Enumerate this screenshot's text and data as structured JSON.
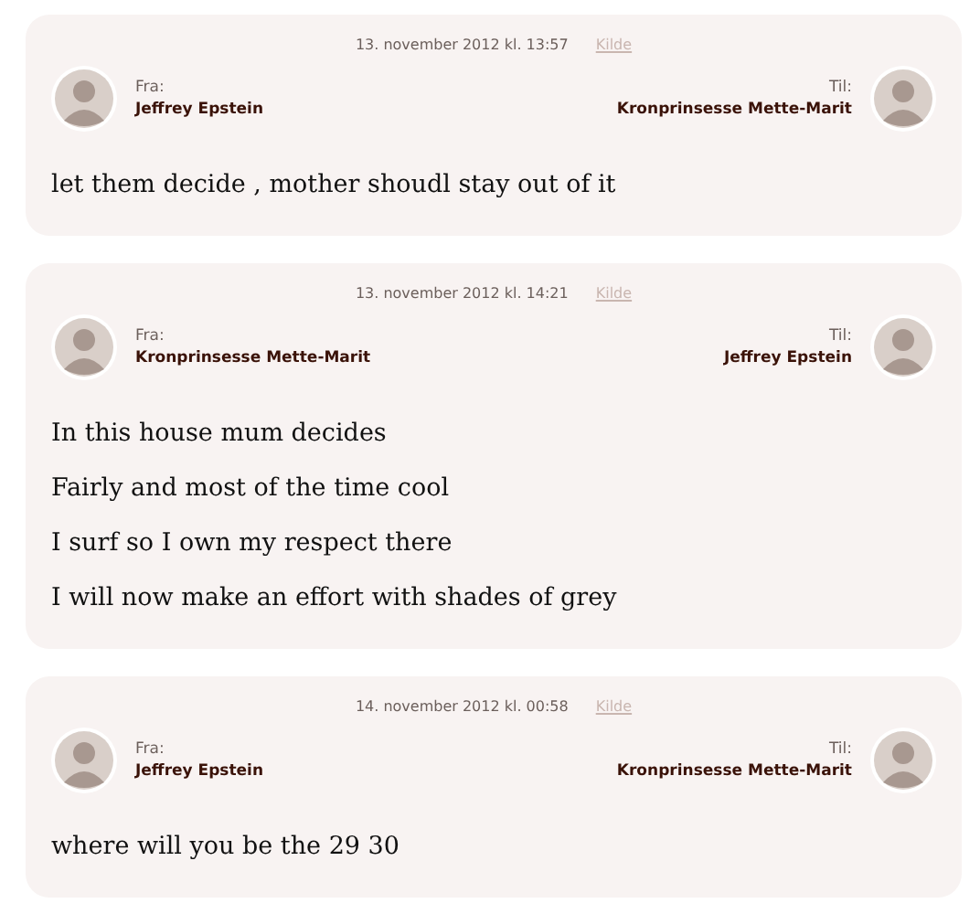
{
  "messages": [
    {
      "timestamp": "13. november 2012 kl. 13:57",
      "source_link": "Kilde",
      "from_label": "Fra:",
      "from": "Jeffrey Epstein",
      "to_label": "Til:",
      "to": "Kronprinsesse Mette-Marit",
      "lines": [
        "let them decide , mother shoudl stay out of it"
      ]
    },
    {
      "timestamp": "13. november 2012 kl. 14:21",
      "source_link": "Kilde",
      "from_label": "Fra:",
      "from": "Kronprinsesse Mette-Marit",
      "to_label": "Til:",
      "to": "Jeffrey Epstein",
      "lines": [
        "In this house mum decides",
        "Fairly and most of the time cool",
        "I surf so I own my respect there",
        "I will now make an effort with shades of grey"
      ]
    },
    {
      "timestamp": "14. november 2012 kl. 00:58",
      "source_link": "Kilde",
      "from_label": "Fra:",
      "from": "Jeffrey Epstein",
      "to_label": "Til:",
      "to": "Kronprinsesse Mette-Marit",
      "lines": [
        "where will you be the 29 30"
      ]
    }
  ]
}
